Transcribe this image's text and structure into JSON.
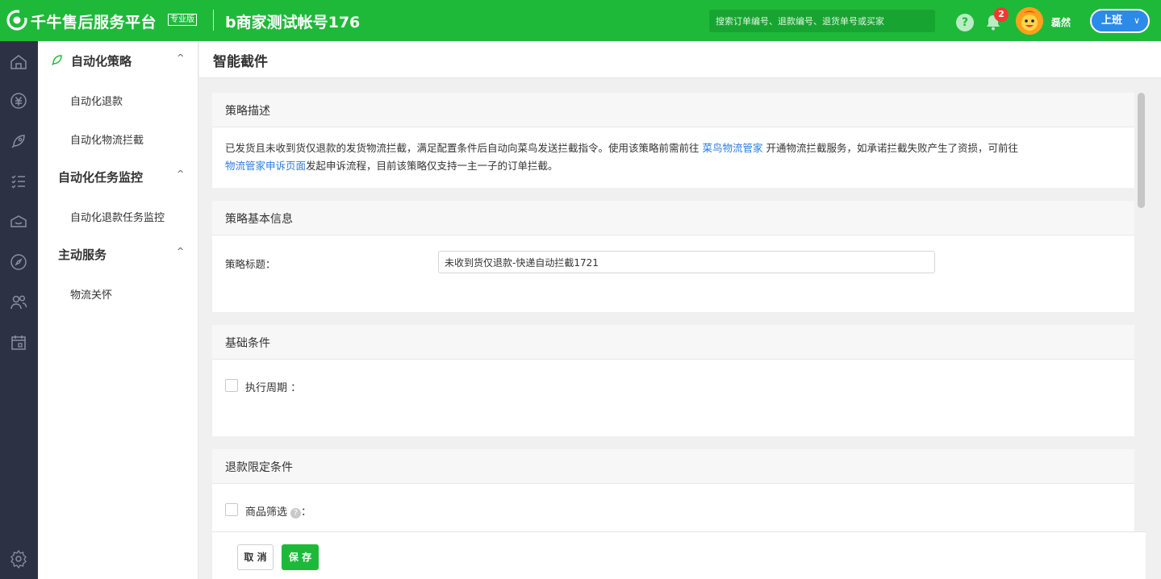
{
  "header": {
    "brand": "千牛售后服务平台",
    "edition": "专业版",
    "account": "b商家测试帐号176",
    "search_placeholder": "搜索订单编号、退款编号、退货单号或买家",
    "notification_count": "2",
    "username": "磊然",
    "shift_button": "上班",
    "shift_caret": "∨"
  },
  "subnav": {
    "groups": [
      {
        "title": "自动化策略",
        "caret": "^",
        "items": [
          "自动化退款",
          "自动化物流拦截"
        ]
      },
      {
        "title": "自动化任务监控",
        "caret": "^",
        "items": [
          "自动化退款任务监控"
        ]
      },
      {
        "title": "主动服务",
        "caret": "^",
        "items": [
          "物流关怀"
        ]
      }
    ]
  },
  "page": {
    "title": "智能截件",
    "desc_section": {
      "title": "策略描述",
      "text1": "已发货且未收到货仅退款的发货物流拦截，满足配置条件后自动向菜鸟发送拦截指令。使用该策略前需前往 ",
      "link1": "菜鸟物流管家",
      "text2": " 开通物流拦截服务，如承诺拦截失败产生了资损，可前往",
      "link2": "物流管家申诉页面",
      "text3": "发起申诉流程，目前该策略仅支持一主一子的订单拦截。"
    },
    "basic_section": {
      "title": "策略基本信息",
      "label": "策略标题：",
      "value": "未收到货仅退款-快递自动拦截1721"
    },
    "base_cond_section": {
      "title": "基础条件",
      "checkbox_label": "执行周期 ："
    },
    "refund_cond_section": {
      "title": "退款限定条件",
      "checkbox_label": "商品筛选",
      "help_glyph": "?",
      "colon": "："
    },
    "footer": {
      "cancel": "取 消",
      "save": "保 存"
    }
  }
}
